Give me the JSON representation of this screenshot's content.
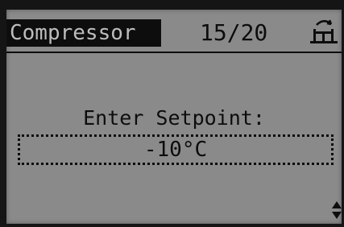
{
  "header": {
    "menu_title": "Compressor",
    "page_counter": "15/20",
    "icon": "menu-tree-icon"
  },
  "main": {
    "prompt": "Enter Setpoint:",
    "value": "-10°C"
  },
  "footer": {
    "icon": "up-down-arrows-icon"
  },
  "colors": {
    "lcd_background": "#8a8a8a",
    "pixel_on": "#0d0d0d",
    "bezel": "#151515"
  }
}
